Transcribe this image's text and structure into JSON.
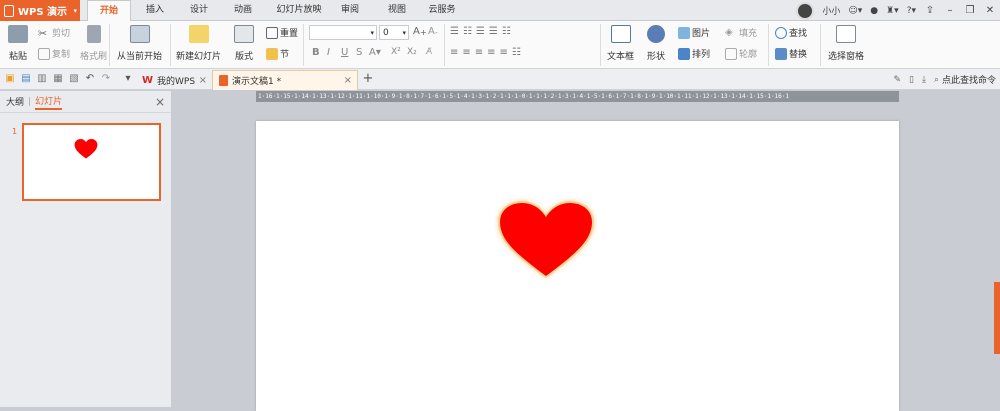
{
  "app": {
    "name": "WPS 演示"
  },
  "menu_tabs": [
    "开始",
    "插入",
    "设计",
    "动画",
    "幻灯片放映",
    "审阅",
    "视图",
    "云服务"
  ],
  "title_right": {
    "user": "小小"
  },
  "ribbon": {
    "paste": "粘贴",
    "cut": "剪切",
    "copy": "复制",
    "format_painter": "格式刷",
    "from_current": "从当前开始",
    "new_slide": "新建幻灯片",
    "layout": "版式",
    "reset": "重置",
    "section": "节",
    "font_size": "0",
    "text_box": "文本框",
    "shape": "形状",
    "picture": "图片",
    "fill": "填充",
    "arrange": "排列",
    "outline": "轮廓",
    "find": "查找",
    "replace": "替换",
    "selection_pane": "选择窗格"
  },
  "doc_tabs": [
    {
      "label": "我的WPS"
    },
    {
      "label": "演示文稿1 *"
    }
  ],
  "qat": {
    "find_command": "点此查找命令"
  },
  "left_panel": {
    "tab_outline": "大纲",
    "tab_slides": "幻灯片",
    "slide_number": "1"
  },
  "ruler": {
    "text": "1·16·1·15·1·14·1·13·1·12·1·11·1·10·1·9·1·8·1·7·1·6·1·5·1·4·1·3·1·2·1·1·1·0·1·1·1·2·1·3·1·4·1·5·1·6·1·7·1·8·1·9·1·10·1·11·1·12·1·13·1·14·1·15·1·16·1"
  },
  "colors": {
    "accent": "#e9632b",
    "heart": "#ff0000",
    "heart_glow": "#f5c77a"
  }
}
